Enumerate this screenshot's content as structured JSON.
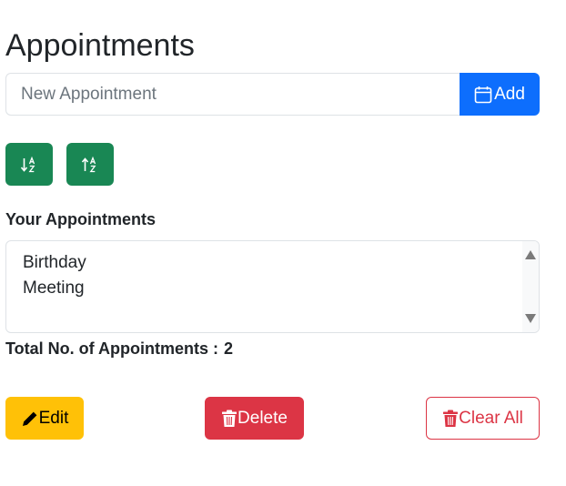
{
  "page": {
    "title": "Appointments"
  },
  "form": {
    "input_placeholder": "New Appointment",
    "input_value": "",
    "add_label": "Add",
    "add_icon": "calendar-icon"
  },
  "sort": {
    "ascending_icon": "sort-alpha-down-icon",
    "descending_icon": "sort-alpha-up-icon"
  },
  "list": {
    "label": "Your Appointments",
    "items": [
      "Birthday",
      "Meeting"
    ]
  },
  "summary": {
    "label": "Total No. of Appointments :",
    "count": "2"
  },
  "actions": {
    "edit_label": "Edit",
    "edit_icon": "pencil-icon",
    "delete_label": "Delete",
    "delete_icon": "trash-icon",
    "clear_label": "Clear All",
    "clear_icon": "trash-icon"
  },
  "colors": {
    "primary": "#0d6efd",
    "success": "#198754",
    "warning": "#ffc107",
    "danger": "#dc3545",
    "text": "#212529"
  }
}
